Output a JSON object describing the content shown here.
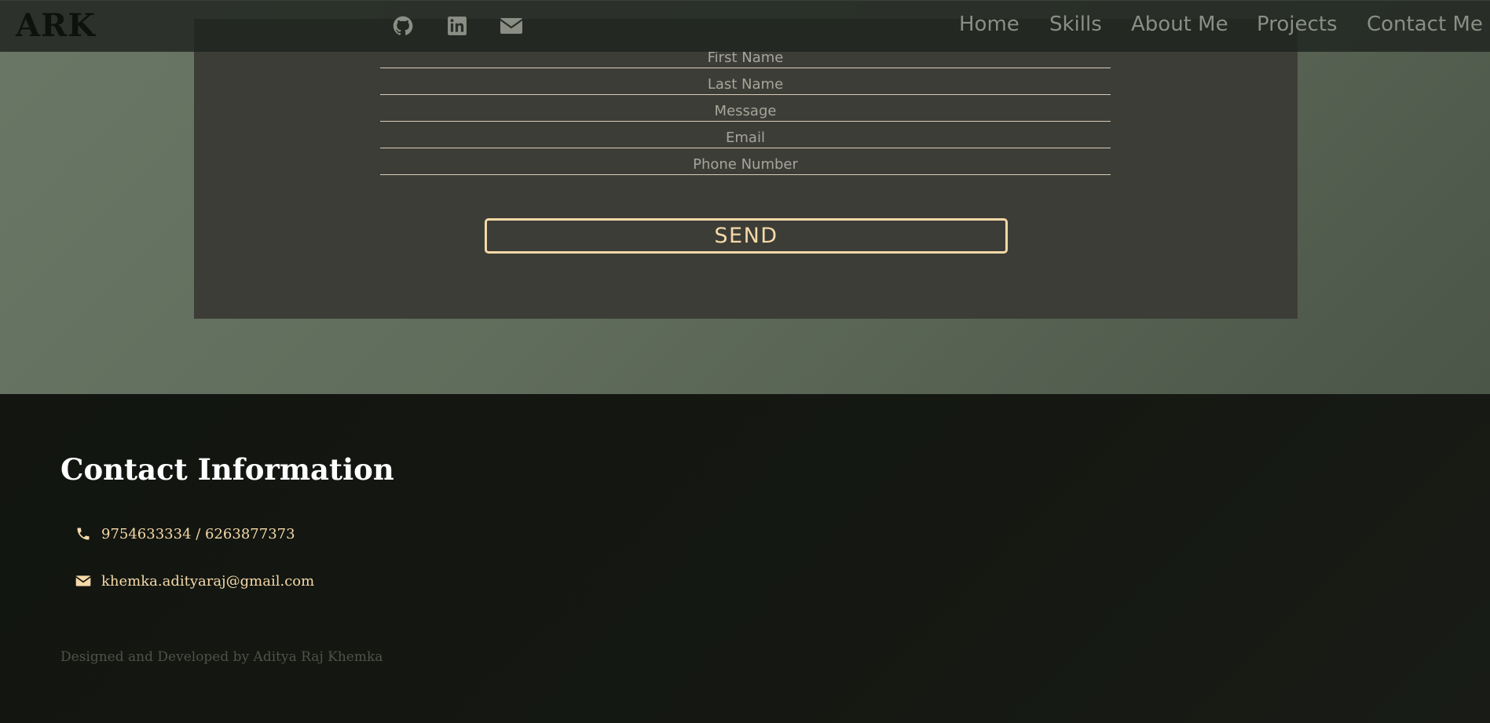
{
  "navbar": {
    "logo": "ARK",
    "social_icons": [
      "github-icon",
      "linkedin-icon",
      "envelope-icon"
    ],
    "links": [
      "Home",
      "Skills",
      "About Me",
      "Projects",
      "Contact Me"
    ]
  },
  "form": {
    "fields": [
      {
        "placeholder": "First Name"
      },
      {
        "placeholder": "Last Name"
      },
      {
        "placeholder": "Message"
      },
      {
        "placeholder": "Email"
      },
      {
        "placeholder": "Phone Number"
      }
    ],
    "submit_label": "SEND"
  },
  "footer": {
    "title": "Contact Information",
    "phone": "9754633334 / 6263877373",
    "email": "khemka.adityaraj@gmail.com",
    "credit": "Designed and Developed by Aditya Raj Khemka"
  },
  "colors": {
    "accent": "#f5d9a8",
    "nav_text": "#8a8e84",
    "panel": "#3d3d37",
    "footer_bg": "#131610"
  }
}
